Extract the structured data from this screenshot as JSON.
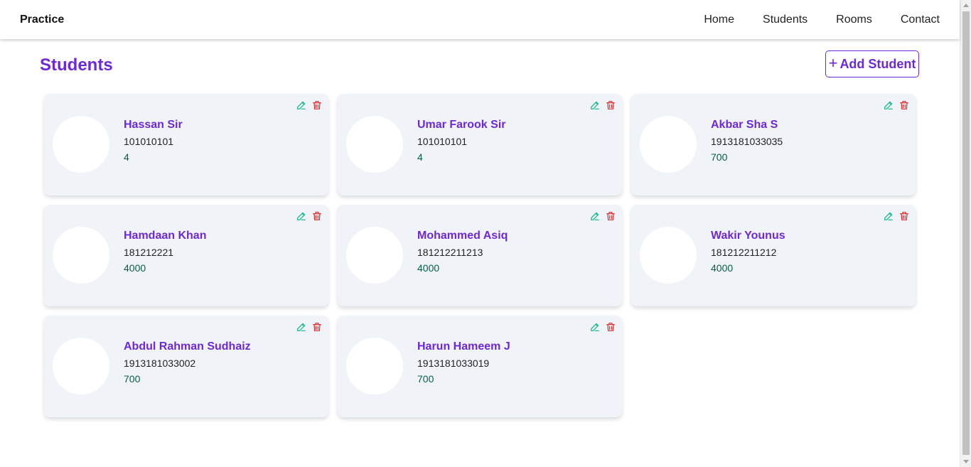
{
  "navbar": {
    "brand": "Practice",
    "links": [
      "Home",
      "Students",
      "Rooms",
      "Contact"
    ]
  },
  "page": {
    "title": "Students",
    "add_button_label": "Add Student"
  },
  "colors": {
    "accent": "#6d28d9",
    "edit": "#10b981",
    "delete": "#dc2626",
    "card_bg": "#f0f3f8"
  },
  "icons": {
    "edit": "pencil-icon",
    "delete": "trash-icon",
    "add": "plus-icon"
  },
  "students": [
    {
      "name": "Hassan Sir",
      "id": "101010101",
      "room": "4"
    },
    {
      "name": "Umar Farook Sir",
      "id": "101010101",
      "room": "4"
    },
    {
      "name": "Akbar Sha S",
      "id": "1913181033035",
      "room": "700"
    },
    {
      "name": "Hamdaan Khan",
      "id": "181212221",
      "room": "4000"
    },
    {
      "name": "Mohammed Asiq",
      "id": "181212211213",
      "room": "4000"
    },
    {
      "name": "Wakir Younus",
      "id": "181212211212",
      "room": "4000"
    },
    {
      "name": "Abdul Rahman Sudhaiz",
      "id": "1913181033002",
      "room": "700"
    },
    {
      "name": "Harun Hameem J",
      "id": "1913181033019",
      "room": "700"
    }
  ]
}
